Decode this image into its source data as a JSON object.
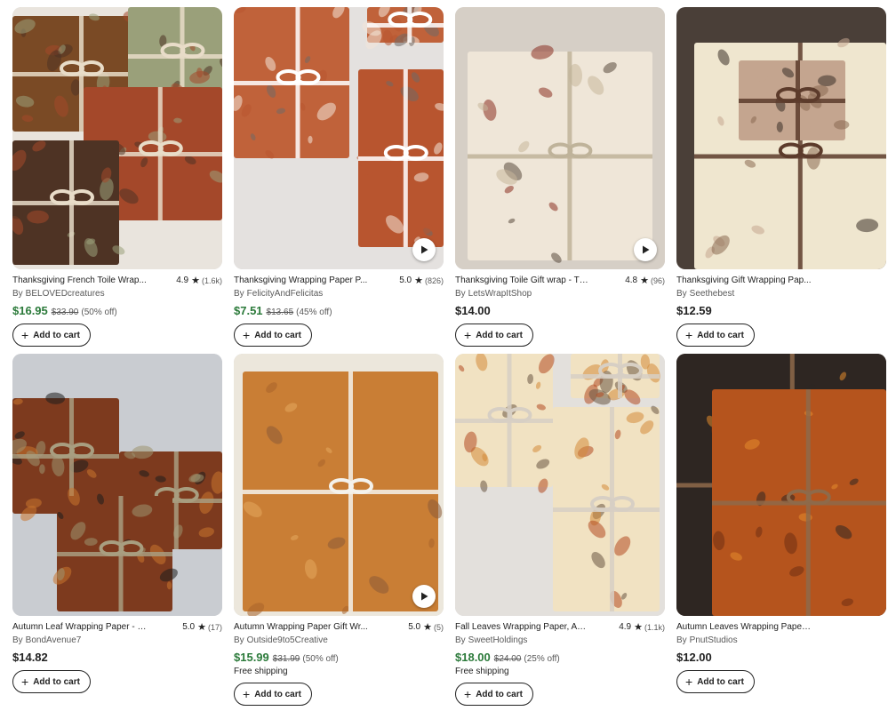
{
  "cart_label": "Add to cart",
  "by_label": "By",
  "products": [
    {
      "title": "Thanksgiving French Toile Wrap...",
      "rating": "4.9",
      "reviews": "(1.6k)",
      "shop": "BELOVEDcreatures",
      "price": "$16.95",
      "original_price": "$33.90",
      "discount": "(50% off)",
      "shipping": "",
      "on_sale": true,
      "has_video": false
    },
    {
      "title": "Thanksgiving Wrapping Paper P...",
      "rating": "5.0",
      "reviews": "(826)",
      "shop": "FelicityAndFelicitas",
      "price": "$7.51",
      "original_price": "$13.65",
      "discount": "(45% off)",
      "shipping": "",
      "on_sale": true,
      "has_video": true
    },
    {
      "title": "Thanksgiving Toile Gift wrap - Th...",
      "rating": "4.8",
      "reviews": "(96)",
      "shop": "LetsWrapItShop",
      "price": "$14.00",
      "original_price": "",
      "discount": "",
      "shipping": "",
      "on_sale": false,
      "has_video": true
    },
    {
      "title": "Thanksgiving Gift Wrapping Pap...",
      "rating": "",
      "reviews": "",
      "shop": "Seethebest",
      "price": "$12.59",
      "original_price": "",
      "discount": "",
      "shipping": "",
      "on_sale": false,
      "has_video": false
    },
    {
      "title": "Autumn Leaf Wrapping Paper - P...",
      "rating": "5.0",
      "reviews": "(17)",
      "shop": "BondAvenue7",
      "price": "$14.82",
      "original_price": "",
      "discount": "",
      "shipping": "",
      "on_sale": false,
      "has_video": false
    },
    {
      "title": "Autumn Wrapping Paper Gift Wr...",
      "rating": "5.0",
      "reviews": "(5)",
      "shop": "Outside9to5Creative",
      "price": "$15.99",
      "original_price": "$31.99",
      "discount": "(50% off)",
      "shipping": "Free shipping",
      "on_sale": true,
      "has_video": true
    },
    {
      "title": "Fall Leaves Wrapping Paper, Aut...",
      "rating": "4.9",
      "reviews": "(1.1k)",
      "shop": "SweetHoldings",
      "price": "$18.00",
      "original_price": "$24.00",
      "discount": "(25% off)",
      "shipping": "Free shipping",
      "on_sale": true,
      "has_video": false
    },
    {
      "title": "Autumn Leaves Wrapping Paper,...",
      "rating": "",
      "reviews": "",
      "shop": "PnutStudios",
      "price": "$12.00",
      "original_price": "",
      "discount": "",
      "shipping": "",
      "on_sale": false,
      "has_video": false
    }
  ],
  "colors": {
    "sale_price": "#2b7a3a",
    "text": "#222222",
    "muted": "#595959",
    "thumbs": [
      {
        "bg": "#e9e4dd",
        "a": "#7a4a25",
        "b": "#9aa07a",
        "c": "#a4482a",
        "d": "#4e3324",
        "ribbon": "#e8dcc8"
      },
      {
        "bg": "#e4e1df",
        "a": "#c0623a",
        "b": "#b8552f",
        "c": "#f2e6d8",
        "d": "#6f6a66",
        "ribbon": "#ffffff"
      },
      {
        "bg": "#d6cfc6",
        "a": "#efe6d8",
        "b": "#8a2f22",
        "c": "#c7b79a",
        "d": "#5a4b3e",
        "ribbon": "#bfb39a"
      },
      {
        "bg": "#4a3f38",
        "a": "#efe6cf",
        "b": "#c4a58f",
        "c": "#8b6a52",
        "d": "#3a3028",
        "ribbon": "#5c3b2b"
      },
      {
        "bg": "#c9ccd1",
        "a": "#7d3a1e",
        "b": "#c8742e",
        "c": "#9c9470",
        "d": "#1e1e1e",
        "ribbon": "#a89e80"
      },
      {
        "bg": "#ece7dc",
        "a": "#c97e35",
        "b": "#a8622a",
        "c": "#e3a85c",
        "d": "#8a5a36",
        "ribbon": "#f4f2ec"
      },
      {
        "bg": "#e3e0dc",
        "a": "#f1e2c2",
        "b": "#b24a22",
        "c": "#d38a3a",
        "d": "#6a5544",
        "ribbon": "#d7cfc4"
      },
      {
        "bg": "#4b4039",
        "a": "#b5541d",
        "b": "#e38a2c",
        "c": "#6d2e12",
        "d": "#2e2622",
        "ribbon": "#8e6a4a"
      }
    ]
  },
  "icons": {
    "rating": "star-icon",
    "video": "play-icon",
    "cart": "plus-icon"
  }
}
